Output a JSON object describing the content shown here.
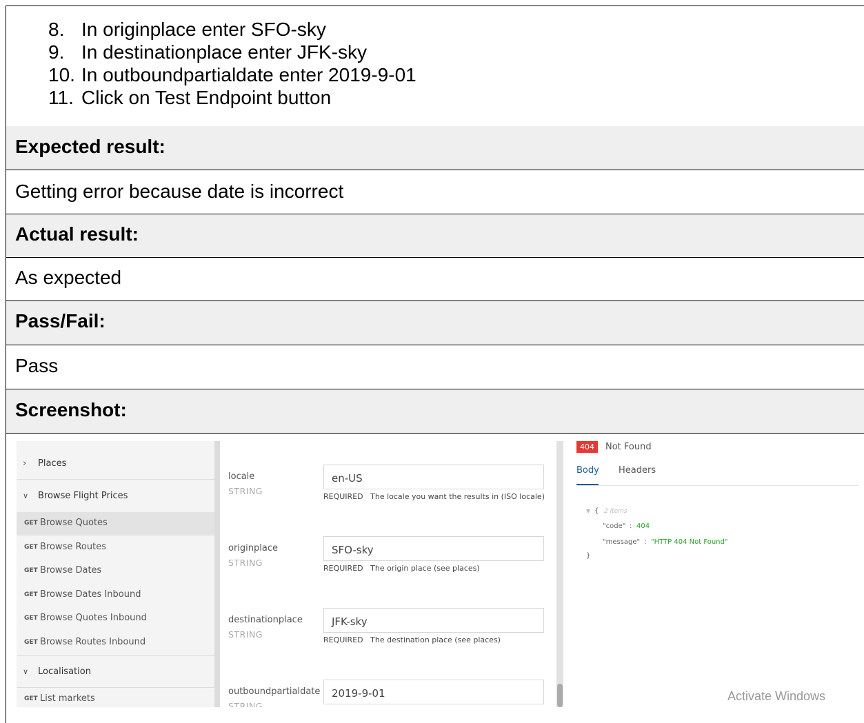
{
  "steps": [
    {
      "num": "8.",
      "text": "In originplace enter SFO-sky"
    },
    {
      "num": "9.",
      "text": "In destinationplace enter JFK-sky"
    },
    {
      "num": "10.",
      "text": "In outboundpartialdate enter 2019-9-01"
    },
    {
      "num": "11.",
      "text": "Click on Test Endpoint button"
    }
  ],
  "sections": {
    "expected_label": "Expected result:",
    "expected_value": "Getting error because date is incorrect",
    "actual_label": "Actual result:",
    "actual_value": "As expected",
    "passfail_label": "Pass/Fail:",
    "passfail_value": "Pass",
    "screenshot_label": "Screenshot:"
  },
  "screenshot": {
    "sidebar": {
      "places": "Places",
      "browse_group": "Browse Flight Prices",
      "items": [
        {
          "method": "GET",
          "label": "Browse Quotes"
        },
        {
          "method": "GET",
          "label": "Browse Routes"
        },
        {
          "method": "GET",
          "label": "Browse Dates"
        },
        {
          "method": "GET",
          "label": "Browse Dates Inbound"
        },
        {
          "method": "GET",
          "label": "Browse Quotes Inbound"
        },
        {
          "method": "GET",
          "label": "Browse Routes Inbound"
        }
      ],
      "localisation_group": "Localisation",
      "list_markets": {
        "method": "GET",
        "label": "List markets"
      }
    },
    "params": [
      {
        "name": "locale",
        "type": "STRING",
        "value": "en-US",
        "required": "REQUIRED",
        "desc": "The locale you want the results in (ISO locale)"
      },
      {
        "name": "originplace",
        "type": "STRING",
        "value": "SFO-sky",
        "required": "REQUIRED",
        "desc": "The origin place (see places)"
      },
      {
        "name": "destinationplace",
        "type": "STRING",
        "value": "JFK-sky",
        "required": "REQUIRED",
        "desc": "The destination place (see places)"
      },
      {
        "name": "outboundpartialdate",
        "type": "STRING",
        "value": "2019-9-01"
      }
    ],
    "response": {
      "status_code": "404",
      "status_text": "Not Found",
      "tabs": [
        "Body",
        "Headers"
      ],
      "json_items": "2 items",
      "code_key": "\"code\"",
      "code_value": "404",
      "message_key": "\"message\"",
      "message_value": "\"HTTP 404 Not Found\"",
      "colon": ":"
    },
    "watermark": "Activate Windows"
  },
  "colors": {
    "error_badge": "#e53935",
    "tab_active": "#1a5c94",
    "json_number": "#2aa02a",
    "json_string": "#2aa02a"
  }
}
